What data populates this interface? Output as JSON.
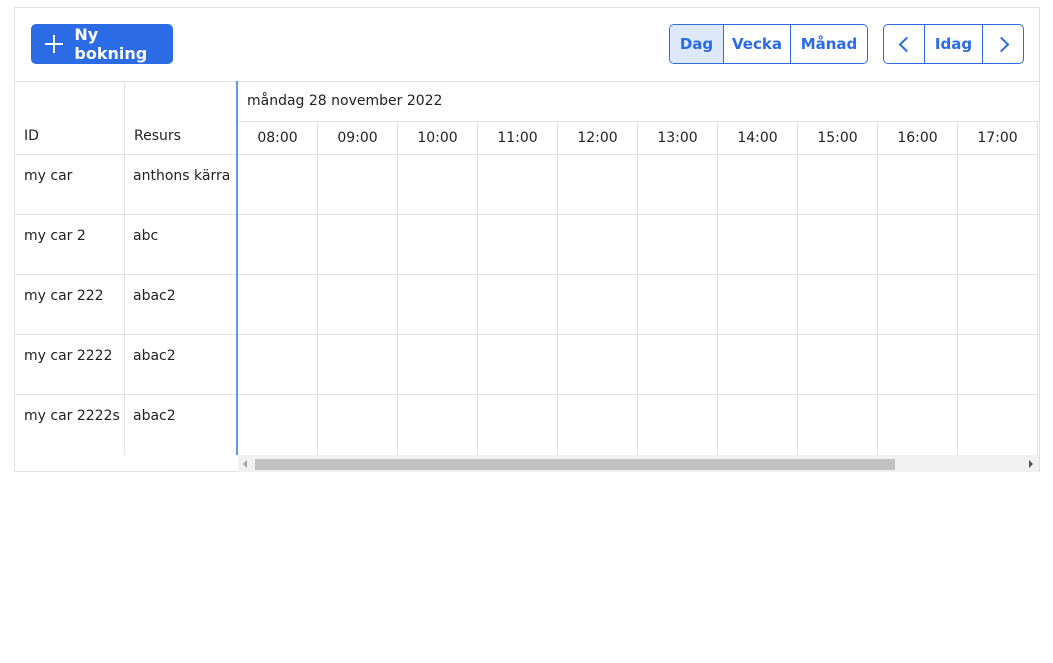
{
  "toolbar": {
    "new_booking_label": "Ny bokning",
    "views": [
      {
        "label": "Dag",
        "active": true
      },
      {
        "label": "Vecka",
        "active": false
      },
      {
        "label": "Månad",
        "active": false
      }
    ],
    "today_label": "Idag"
  },
  "table": {
    "headers": {
      "id": "ID",
      "resource": "Resurs"
    },
    "date_label": "måndag 28 november 2022",
    "hours": [
      "08:00",
      "09:00",
      "10:00",
      "11:00",
      "12:00",
      "13:00",
      "14:00",
      "15:00",
      "16:00",
      "17:00"
    ],
    "rows": [
      {
        "id": "my car",
        "resource": "anthons kärra"
      },
      {
        "id": "my car 2",
        "resource": "abc"
      },
      {
        "id": "my car 222",
        "resource": "abac2"
      },
      {
        "id": "my car 2222",
        "resource": "abac2"
      },
      {
        "id": "my car 2222s",
        "resource": "abac2"
      }
    ]
  },
  "colors": {
    "accent": "#2b6be6",
    "active_bg": "#dde9fb",
    "border": "#e2e2e2"
  },
  "icons": {
    "add": "plus-icon",
    "prev": "chevron-left-icon",
    "next": "chevron-right-icon"
  }
}
